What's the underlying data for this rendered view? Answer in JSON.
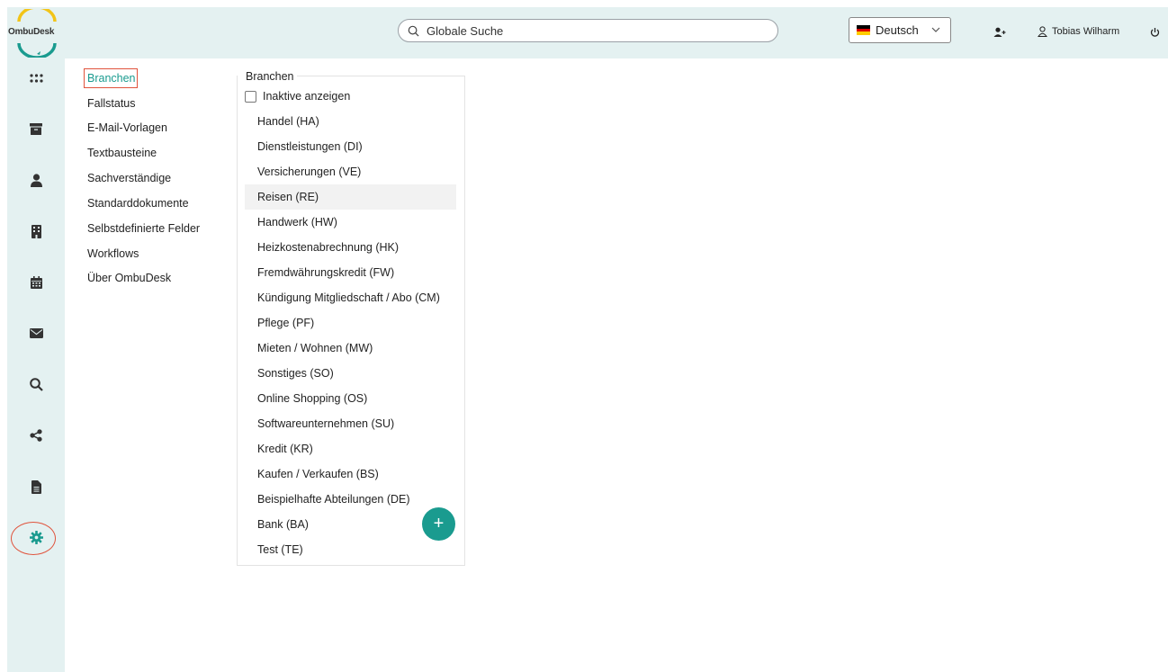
{
  "app": {
    "logo_text": "OmbuDesk"
  },
  "search": {
    "placeholder": "Globale Suche"
  },
  "language": {
    "selected": "Deutsch",
    "flag_colors": [
      "#000000",
      "#dd0000",
      "#ffcc00"
    ]
  },
  "user": {
    "name": "Tobias Wilharm"
  },
  "colors": {
    "accent": "#1a9b8f",
    "highlight": "#e0533c",
    "rail_bg": "#e4f1f1"
  },
  "rail": {
    "icons": [
      "apps-icon",
      "archive-icon",
      "person-icon",
      "building-icon",
      "calendar-icon",
      "mail-icon",
      "search-icon",
      "share-icon",
      "document-icon",
      "settings-icon"
    ]
  },
  "submenu": {
    "items": [
      {
        "label": "Branchen"
      },
      {
        "label": "Fallstatus"
      },
      {
        "label": "E-Mail-Vorlagen"
      },
      {
        "label": "Textbausteine"
      },
      {
        "label": "Sachverständige"
      },
      {
        "label": "Standarddokumente"
      },
      {
        "label": "Selbstdefinierte Felder"
      },
      {
        "label": "Workflows"
      },
      {
        "label": "Über OmbuDesk"
      }
    ]
  },
  "branches": {
    "title": "Branchen",
    "show_inactive_label": "Inaktive anzeigen",
    "items": [
      "Handel (HA)",
      "Dienstleistungen (DI)",
      "Versicherungen (VE)",
      "Reisen (RE)",
      "Handwerk (HW)",
      "Heizkostenabrechnung (HK)",
      "Fremdwährungskredit (FW)",
      "Kündigung Mitgliedschaft / Abo (CM)",
      "Pflege (PF)",
      "Mieten / Wohnen (MW)",
      "Sonstiges (SO)",
      "Online Shopping (OS)",
      "Softwareunternehmen (SU)",
      "Kredit (KR)",
      "Kaufen / Verkaufen (BS)",
      "Beispielhafte Abteilungen (DE)",
      "Bank (BA)",
      "Test (TE)"
    ],
    "selected_index": 3
  },
  "add_button_label": "+"
}
